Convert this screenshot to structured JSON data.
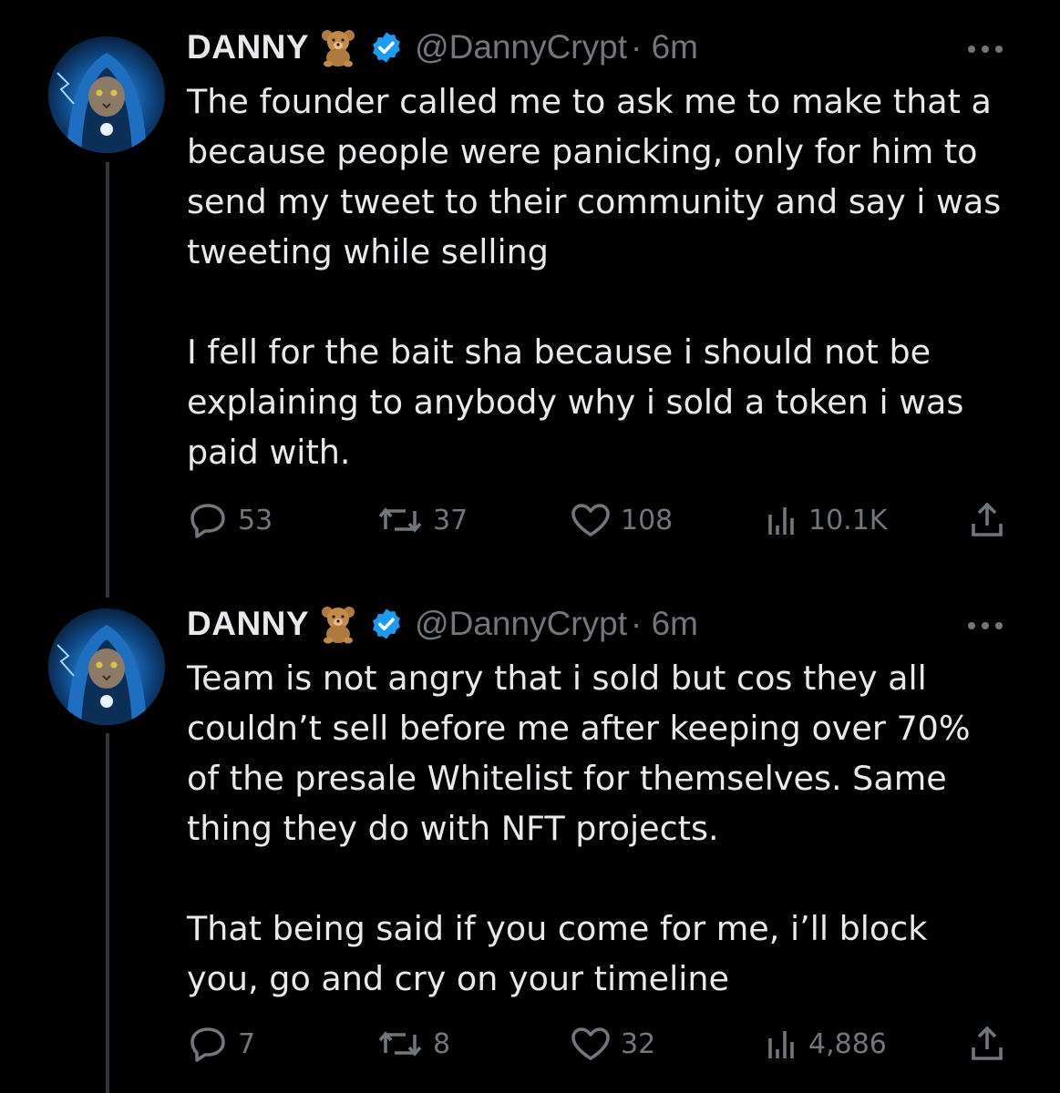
{
  "tweets": [
    {
      "display_name": "DANNY",
      "handle": "@DannyCrypt",
      "time": "· 6m",
      "text": "The founder called me to ask me to make that a because people were panicking, only for him to send my tweet to their community and say i was tweeting while selling\n\nI fell for the bait sha because i should not be explaining to anybody why i sold a token i was paid with.",
      "replies": "53",
      "retweets": "37",
      "likes": "108",
      "views": "10.1K"
    },
    {
      "display_name": "DANNY",
      "handle": "@DannyCrypt",
      "time": "· 6m",
      "text": "Team is not angry that i sold but cos they all couldn’t sell before me after keeping over 70% of the presale Whitelist for themselves. Same thing they do with NFT projects.\n\nThat being said if you come for me, i’ll block you, go and cry on your timeline",
      "replies": "7",
      "retweets": "8",
      "likes": "32",
      "views": "4,886"
    }
  ],
  "icons": {
    "avatar": "hooded-cat-avatar",
    "emoji": "teddy-bear-icon",
    "verified": "verified-badge-icon",
    "more": "more-icon",
    "reply": "reply-icon",
    "retweet": "retweet-icon",
    "like": "like-icon",
    "views": "views-icon",
    "share": "share-icon"
  },
  "colors": {
    "background": "#000000",
    "text": "#e7e9ea",
    "secondary": "#71767b",
    "verified": "#1d9bf0",
    "thread_line": "#333639"
  }
}
